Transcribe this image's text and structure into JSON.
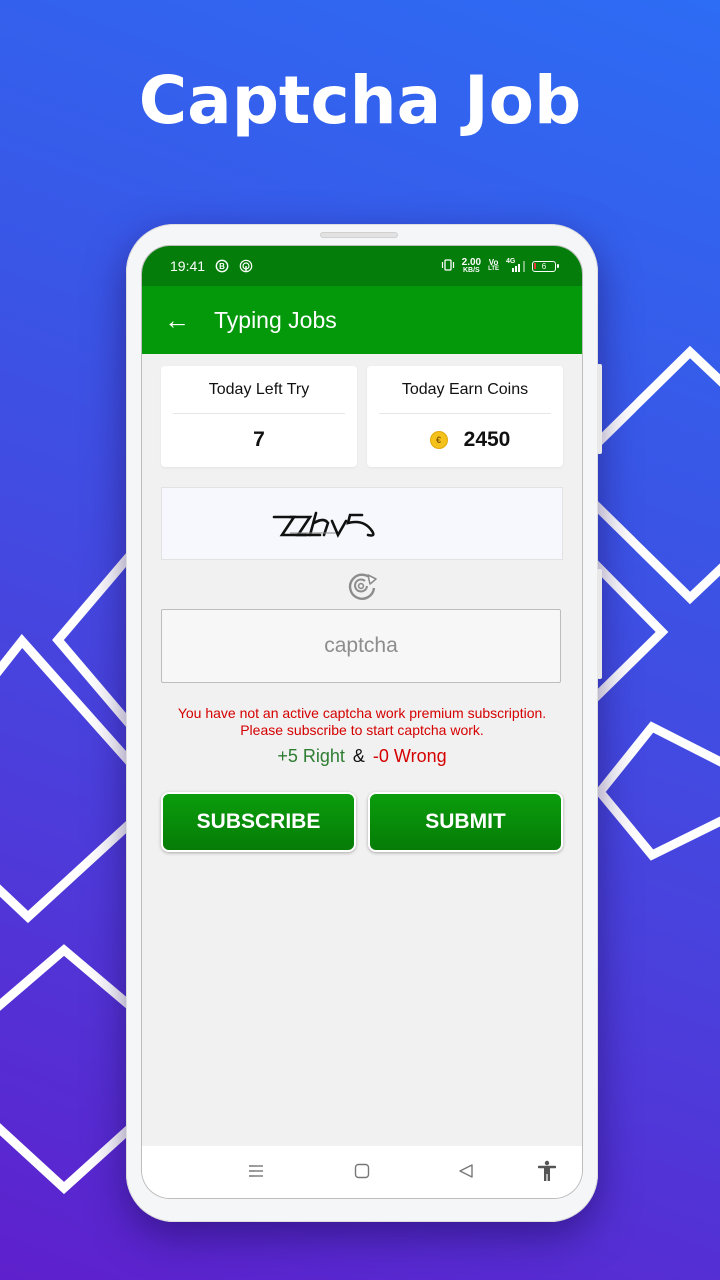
{
  "hero": {
    "title": "Captcha Job"
  },
  "statusbar": {
    "time": "19:41",
    "left_icons": [
      "b-badge-icon",
      "hotspot-icon"
    ],
    "net_speed_value": "2.00",
    "net_speed_unit": "KB/S",
    "volte_top": "Vo",
    "volte_bottom": "LTE",
    "network": "4G",
    "battery_level": "6"
  },
  "appbar": {
    "back_icon": "arrow-left-icon",
    "back_glyph": "←",
    "title": "Typing Jobs"
  },
  "stats": {
    "left_try": {
      "label": "Today Left Try",
      "value": "7"
    },
    "earn_coins": {
      "label": "Today Earn Coins",
      "value": "2450",
      "icon": "coin-icon",
      "coin_glyph": "€"
    }
  },
  "captcha": {
    "image_text": "ZZhv5",
    "refresh_icon": "refresh-icon",
    "input_value": "",
    "input_placeholder": "captcha"
  },
  "notice": {
    "line1": "You have not an active captcha work premium subscription.",
    "line2": "Please subscribe to start captcha work."
  },
  "score": {
    "right": "+5 Right",
    "amp": "&",
    "wrong": "-0 Wrong"
  },
  "buttons": {
    "subscribe": "SUBSCRIBE",
    "submit": "SUBMIT"
  },
  "navbar": {
    "items": [
      "menu-icon",
      "home-icon",
      "back-icon",
      "accessibility-icon"
    ]
  },
  "colors": {
    "status_bar": "#047d0a",
    "app_bar": "#04990a",
    "button": "#078a08",
    "notice_red": "#d50000",
    "right_green": "#2e7d32",
    "bg_top": "#2d6cf4",
    "bg_bottom": "#5e20cc"
  }
}
